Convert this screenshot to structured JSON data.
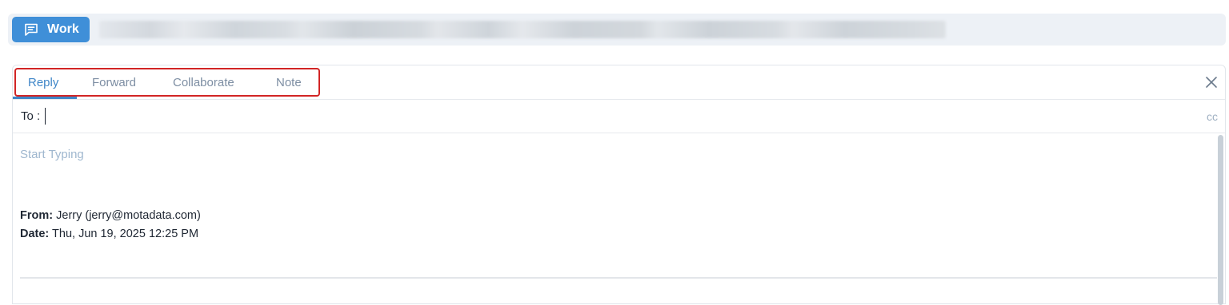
{
  "header": {
    "work_button_label": "Work"
  },
  "reply": {
    "tabs": [
      {
        "label": "Reply",
        "active": true
      },
      {
        "label": "Forward",
        "active": false
      },
      {
        "label": "Collaborate",
        "active": false
      },
      {
        "label": "Note",
        "active": false
      }
    ],
    "to_label": "To :",
    "cc_label": "cc",
    "placeholder": "Start Typing",
    "from_label": "From:",
    "from_value": "Jerry (jerry@motadata.com)",
    "date_label": "Date:",
    "date_value": "Thu, Jun 19, 2025 12:25 PM"
  },
  "colors": {
    "accent": "#3f8fd8",
    "highlight_border": "#d22525",
    "muted_text": "#7d8ea3"
  },
  "icons": {
    "work": "message-square-icon",
    "close": "close-icon"
  }
}
